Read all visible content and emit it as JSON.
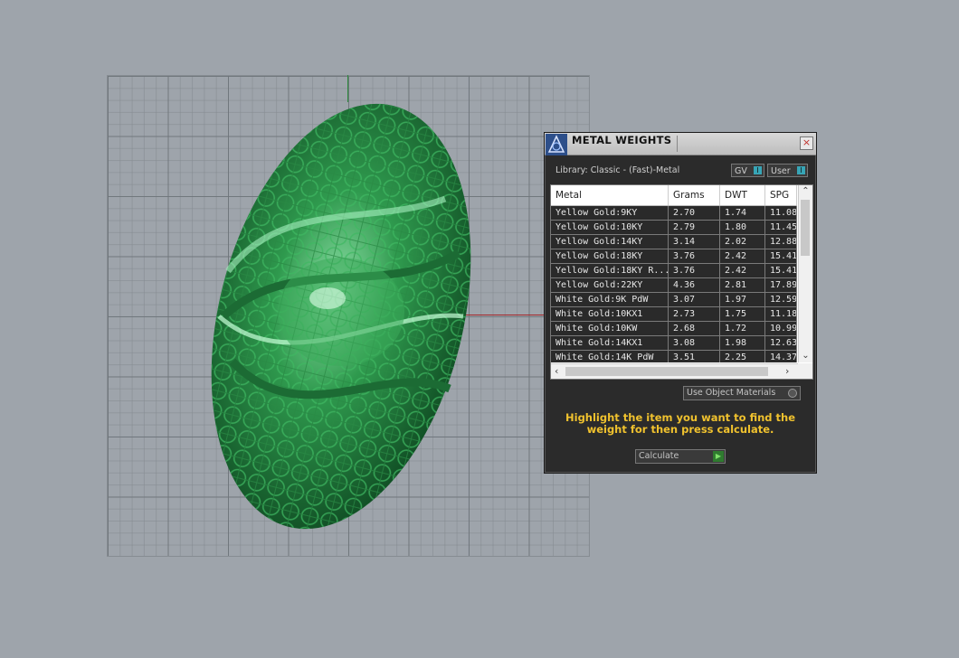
{
  "dialog": {
    "title": "METAL WEIGHTS",
    "close_label": "×",
    "library_label": "Library: Classic - (Fast)-Metal",
    "toggles": {
      "gv": "GV",
      "user": "User"
    },
    "columns": [
      "Metal",
      "Grams",
      "DWT",
      "SPG"
    ],
    "rows": [
      [
        "Yellow Gold:9KY",
        "2.70",
        "1.74",
        "11.08"
      ],
      [
        "Yellow Gold:10KY",
        "2.79",
        "1.80",
        "11.45"
      ],
      [
        "Yellow Gold:14KY",
        "3.14",
        "2.02",
        "12.88"
      ],
      [
        "Yellow Gold:18KY",
        "3.76",
        "2.42",
        "15.41"
      ],
      [
        "Yellow Gold:18KY R...",
        "3.76",
        "2.42",
        "15.41"
      ],
      [
        "Yellow Gold:22KY",
        "4.36",
        "2.81",
        "17.89"
      ],
      [
        "White Gold:9K PdW",
        "3.07",
        "1.97",
        "12.59"
      ],
      [
        "White Gold:10KX1",
        "2.73",
        "1.75",
        "11.18"
      ],
      [
        "White Gold:10KW",
        "2.68",
        "1.72",
        "10.99"
      ],
      [
        "White Gold:14KX1",
        "3.08",
        "1.98",
        "12.63"
      ],
      [
        "White Gold:14K PdW",
        "3.51",
        "2.25",
        "14.37"
      ]
    ],
    "use_object_materials": "Use Object Materials",
    "hint": "Highlight the item you want to find the weight for then press calculate.",
    "calculate_label": "Calculate"
  },
  "icons": {
    "app": "metal-weights-app-icon",
    "close": "close-icon"
  },
  "colors": {
    "model": "#2f9a4e",
    "hint": "#f0c22e",
    "toggle_knob": "#37a5b6"
  }
}
